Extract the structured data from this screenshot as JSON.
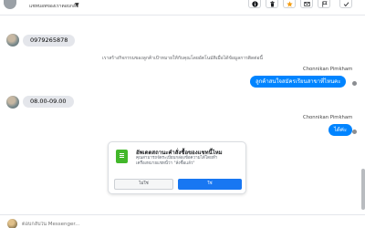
{
  "header": {
    "subtitle": "แชทบอทของเราตอบกลับ",
    "toolbar": {
      "info_icon": "info-circle",
      "delete_icon": "trash",
      "star_icon": "star",
      "mail_icon": "envelope",
      "flag_icon": "flag",
      "done_icon": "checkmark"
    }
  },
  "messages": {
    "phone": "0979265878",
    "system_note": "เราสร้างกิจกรรมของลูกค้าเป้าหมายให้กับคุณโดยอัตโนมัติเมื่อได้ข้อมูลการติดต่อนี้",
    "agent_name_1": "Chonnikan Pimkham",
    "agent_reply_1": "ลูกค้าสนใจสมัครเรียนสาขาที่ไหนคะ",
    "time_reply": "08.00-09.00",
    "agent_name_2": "Chonnikan Pimkham",
    "agent_reply_2": "ได้ค่ะ"
  },
  "prompt_card": {
    "title": "อัพเดตสถานะคำสั่งซื้อของแชทนี้ไหม",
    "body_line1": "คุณสามารถจัดระเบียบกล่องข้อความได้โดยทำ",
    "body_line2": "เครื่องหมายแชทนี้ว่า \"สั่งซื้อแล้ว\"",
    "no_label": "ไม่ใช่",
    "yes_label": "ใช่"
  },
  "composer": {
    "placeholder": "ตอบกลับใน Messenger..."
  },
  "colors": {
    "accent_blue": "#1877f2",
    "messenger_blue": "#0084ff",
    "star_orange": "#f39c12",
    "incoming_bubble": "#e4e6eb"
  }
}
